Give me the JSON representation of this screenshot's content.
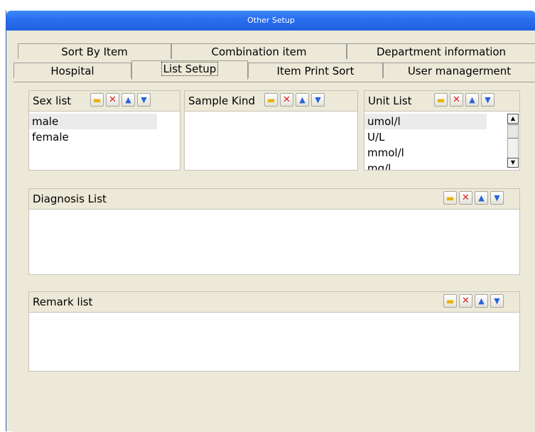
{
  "window": {
    "title": "Other Setup"
  },
  "tabs": {
    "row1": [
      "Sort By Item",
      "Combination item",
      "Department information"
    ],
    "row2": [
      "Hospital",
      "List Setup",
      "Item Print Sort",
      "User managerment"
    ],
    "active": "List Setup"
  },
  "panels": {
    "sex_list": {
      "title": "Sex list",
      "items": [
        "male",
        "female"
      ],
      "selected": "male"
    },
    "sample_kind": {
      "title": "Sample Kind",
      "items": []
    },
    "unit_list": {
      "title": "Unit List",
      "items": [
        "umol/l",
        "U/L",
        "mmol/l",
        "mg/l"
      ],
      "selected": "umol/l"
    },
    "diagnosis_list": {
      "title": "Diagnosis List",
      "items": []
    },
    "remark_list": {
      "title": "Remark list",
      "items": []
    }
  },
  "toolbar_icons": [
    "folder-icon",
    "delete-icon",
    "arrow-up-icon",
    "arrow-down-icon"
  ],
  "colors": {
    "titlebar": "#2b6ff0",
    "face": "#ece9d8",
    "delete": "#e02020",
    "arrow": "#2a63d6",
    "folder": "#e8b400"
  }
}
